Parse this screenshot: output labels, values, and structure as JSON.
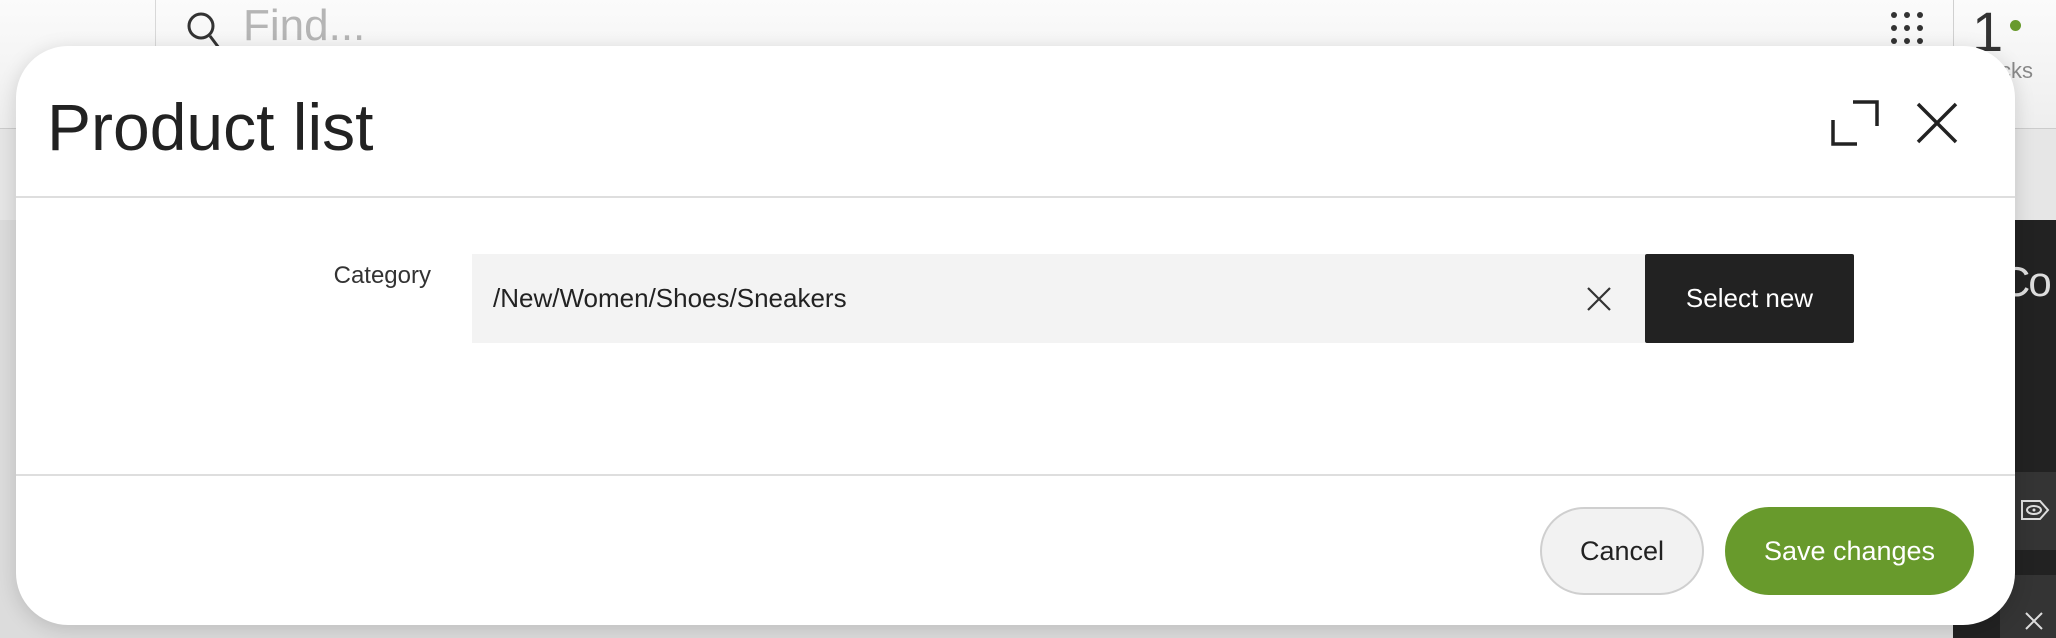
{
  "background": {
    "search_placeholder": "Find...",
    "notification_count": "1",
    "partial_label": "cks",
    "panel_partial_text": "Co"
  },
  "dialog": {
    "title": "Product list",
    "category_label": "Category",
    "category_value": "/New/Women/Shoes/Sneakers",
    "select_new_label": "Select new",
    "cancel_label": "Cancel",
    "save_label": "Save changes"
  },
  "colors": {
    "accent": "#689a2c",
    "dark_button": "#222222",
    "field_bg": "#f3f3f3"
  }
}
